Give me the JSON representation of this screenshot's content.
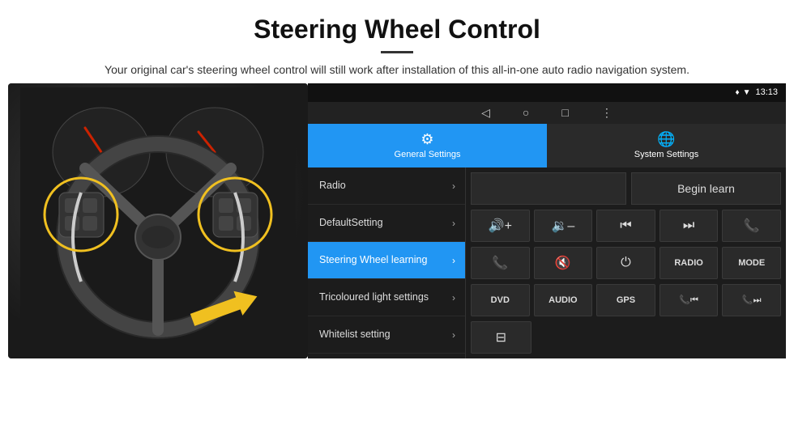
{
  "header": {
    "title": "Steering Wheel Control",
    "subtitle": "Your original car's steering wheel control will still work after installation of this all-in-one auto radio navigation system."
  },
  "status_bar": {
    "time": "13:13",
    "icons": [
      "location",
      "wifi",
      "signal"
    ]
  },
  "nav_buttons": [
    "◁",
    "○",
    "□",
    "⋮"
  ],
  "tabs": [
    {
      "id": "general",
      "label": "General Settings",
      "icon": "⚙",
      "active": true
    },
    {
      "id": "system",
      "label": "System Settings",
      "icon": "🌐",
      "active": false
    }
  ],
  "menu": {
    "items": [
      {
        "id": "radio",
        "label": "Radio",
        "active": false
      },
      {
        "id": "default",
        "label": "DefaultSetting",
        "active": false
      },
      {
        "id": "steering",
        "label": "Steering Wheel learning",
        "active": true
      },
      {
        "id": "tricoloured",
        "label": "Tricoloured light settings",
        "active": false
      },
      {
        "id": "whitelist",
        "label": "Whitelist setting",
        "active": false
      }
    ]
  },
  "controls": {
    "begin_learn": "Begin learn",
    "buttons_row1": [
      {
        "id": "vol-up",
        "symbol": "🔊+",
        "label": "Vol Up"
      },
      {
        "id": "vol-down",
        "symbol": "🔉-",
        "label": "Vol Down"
      },
      {
        "id": "prev-track",
        "symbol": "⏮",
        "label": "Prev"
      },
      {
        "id": "next-track",
        "symbol": "⏭",
        "label": "Next"
      },
      {
        "id": "phone",
        "symbol": "📞",
        "label": "Phone"
      }
    ],
    "buttons_row2": [
      {
        "id": "call-answer",
        "symbol": "📞",
        "label": "Answer"
      },
      {
        "id": "mute",
        "symbol": "🔇",
        "label": "Mute"
      },
      {
        "id": "power",
        "symbol": "⏻",
        "label": "Power"
      },
      {
        "id": "radio-btn",
        "symbol": "RADIO",
        "label": "Radio"
      },
      {
        "id": "mode",
        "symbol": "MODE",
        "label": "Mode"
      }
    ],
    "buttons_row3": [
      {
        "id": "dvd",
        "symbol": "DVD",
        "label": "DVD"
      },
      {
        "id": "audio",
        "symbol": "AUDIO",
        "label": "Audio"
      },
      {
        "id": "gps",
        "symbol": "GPS",
        "label": "GPS"
      },
      {
        "id": "tel-prev",
        "symbol": "📞⏮",
        "label": "Tel Prev"
      },
      {
        "id": "tel-next",
        "symbol": "📞⏭",
        "label": "Tel Next"
      }
    ],
    "button_last": {
      "id": "settings-extra",
      "symbol": "⊟",
      "label": "Extra"
    }
  }
}
